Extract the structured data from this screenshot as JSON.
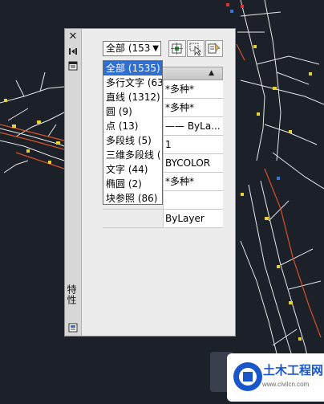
{
  "palette": {
    "title": "特性",
    "selector": {
      "value": "全部 (153"
    },
    "toolbar": {
      "quick_select_icon": "quick-select-icon",
      "select_objects_icon": "select-objects-icon",
      "pickadd_icon": "pickadd-toggle-icon"
    },
    "properties": [
      {
        "value": "*多种*"
      },
      {
        "value": "*多种*"
      },
      {
        "value": "—— ByLa..."
      },
      {
        "value": "1"
      },
      {
        "value": "BYCOLOR"
      },
      {
        "value": "*多种*"
      },
      {
        "value": ""
      },
      {
        "value": "ByLayer"
      }
    ]
  },
  "dropdown": {
    "selected_index": 0,
    "options": [
      "全部 (1535)",
      "多行文字 (63)",
      "直线 (1312)",
      "圆 (9)",
      "点 (13)",
      "多段线 (5)",
      "三维多段线 (",
      "文字 (44)",
      "椭圆 (2)",
      "块参照 (86)"
    ]
  },
  "watermark": {
    "brand": "土木工程网",
    "url": "www.civilcn.com",
    "accent": "#1a56c9"
  }
}
